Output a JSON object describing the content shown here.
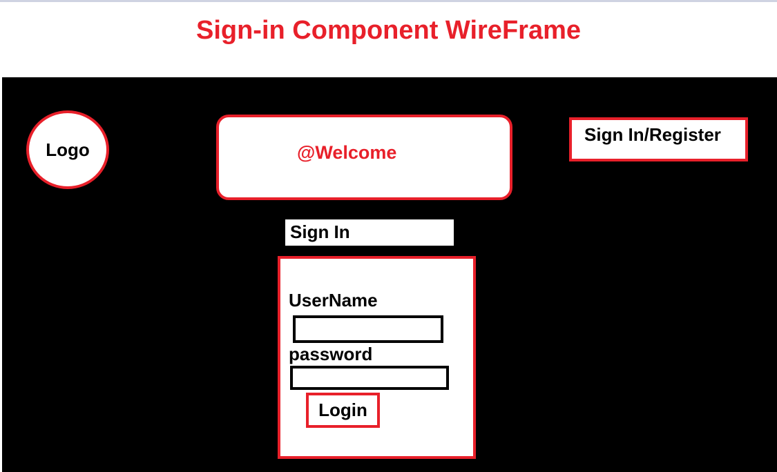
{
  "page": {
    "title": "Sign-in Component WireFrame"
  },
  "header": {
    "logo_label": "Logo",
    "welcome_text": "@Welcome",
    "signin_register_label": "Sign In/Register"
  },
  "signin": {
    "heading": "Sign In",
    "username_label": "UserName",
    "username_value": "",
    "password_label": "password",
    "password_value": "",
    "login_label": "Login"
  },
  "colors": {
    "accent": "#e8202a",
    "canvas": "#000000",
    "panel": "#ffffff"
  }
}
